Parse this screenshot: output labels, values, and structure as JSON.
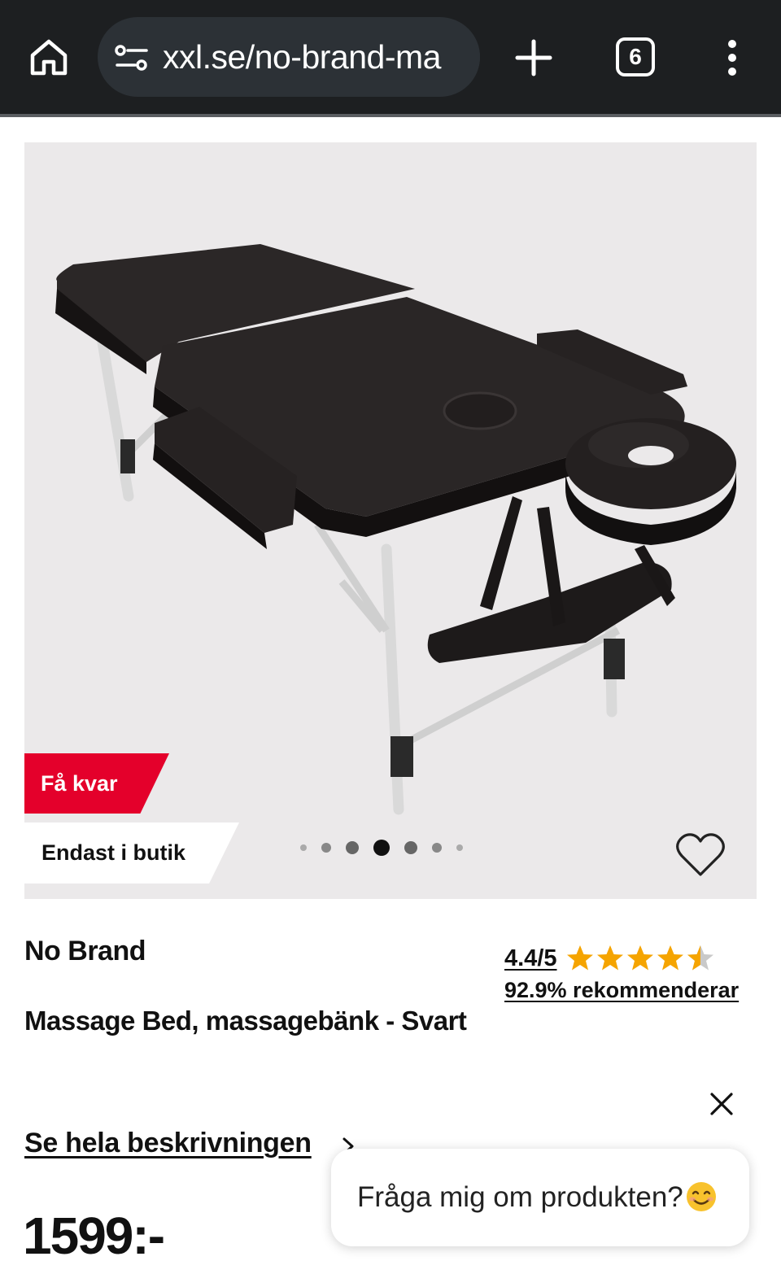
{
  "browser": {
    "url": "xxl.se/no-brand-ma",
    "tab_count": "6",
    "icons": [
      "home-icon",
      "site-settings-icon",
      "new-tab-plus-icon",
      "tab-switcher-icon",
      "more-menu-icon"
    ]
  },
  "gallery": {
    "badge_low_stock": "Få kvar",
    "badge_store_only": "Endast i butik",
    "image_count": 7,
    "active_image_index": 3,
    "wishlist_icon": "heart-outline-icon"
  },
  "product": {
    "brand": "No Brand",
    "title": "Massage Bed, massagebänk - Svart",
    "rating_text": "4.4/5",
    "rating_value": 4.4,
    "rating_max": 5,
    "recommend_text": "92.9% rekommenderar",
    "description_link": "Se hela beskrivningen",
    "price": "1599:-"
  },
  "chat": {
    "prompt": "Fråga mig om produkten?",
    "emoji_icon": "smiling-face-emoji-icon"
  },
  "colors": {
    "browser_bar": "#1d1f21",
    "url_box": "#2c3136",
    "badge_red": "#e4002b",
    "star": "#f5a400",
    "gallery_bg": "#ebe9ea"
  }
}
